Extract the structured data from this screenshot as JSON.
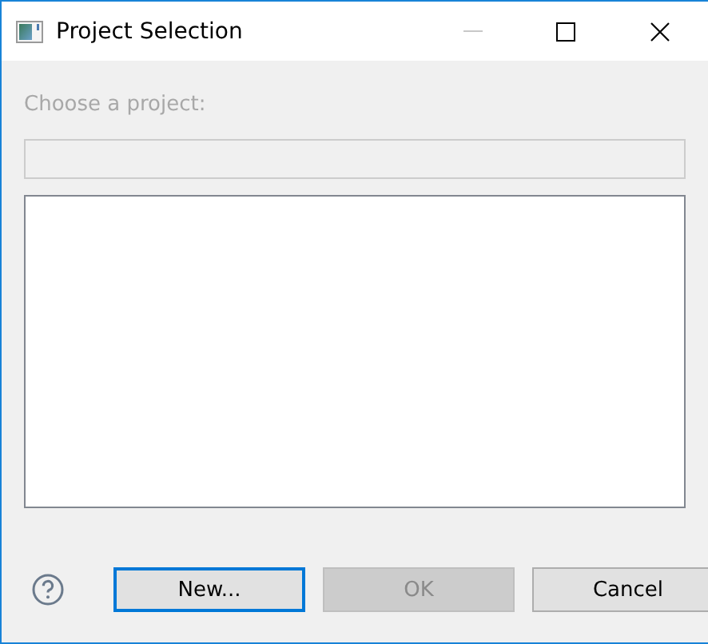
{
  "window": {
    "title": "Project Selection",
    "minimize_disabled": true
  },
  "prompt": {
    "label": "Choose a project:",
    "disabled": true
  },
  "filter_field": {
    "disabled": true
  },
  "project_list": {
    "kind": "empty"
  },
  "buttons": [
    {
      "label": "New...",
      "disabled": false,
      "focused": true
    },
    {
      "label": "OK",
      "disabled": true,
      "focused": false
    },
    {
      "label": "Cancel",
      "disabled": false,
      "focused": false
    }
  ]
}
